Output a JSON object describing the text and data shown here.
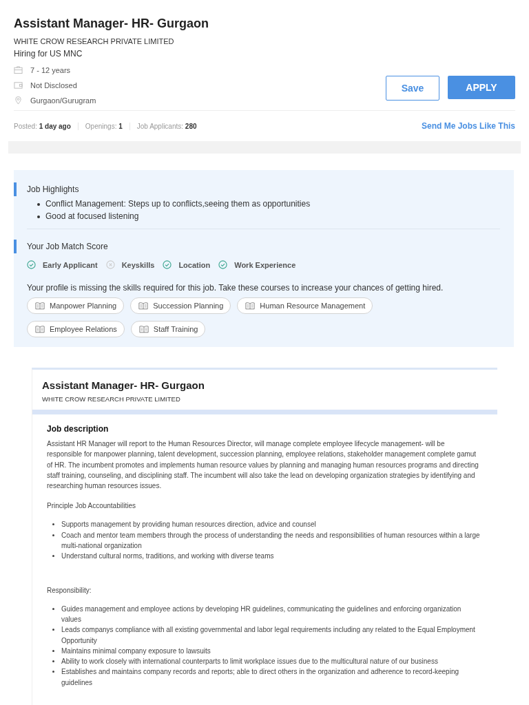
{
  "job": {
    "title": "Assistant Manager- HR- Gurgaon",
    "company": "WHITE CROW RESEARCH PRIVATE LIMITED",
    "hiring_for": "Hiring for US MNC",
    "details": [
      {
        "kind": "experience",
        "text": "7 - 12 years"
      },
      {
        "kind": "salary",
        "text": "Not Disclosed"
      },
      {
        "kind": "location",
        "text": "Gurgaon/Gurugram"
      }
    ],
    "buttons": {
      "save": "Save",
      "apply": "APPLY"
    },
    "stats": [
      {
        "label": "Posted:",
        "value": "1 day ago"
      },
      {
        "label": "Openings:",
        "value": "1"
      },
      {
        "label": "Job Applicants:",
        "value": "280"
      }
    ],
    "send_link": "Send Me Jobs Like This"
  },
  "highlights": {
    "title": "Job Highlights",
    "items": [
      "Conflict Management: Steps up to conflicts,seeing them as opportunities",
      "Good at focused listening"
    ]
  },
  "match_score": {
    "title": "Your Job Match Score",
    "items": [
      {
        "label": "Early Applicant",
        "checked": true
      },
      {
        "label": "Keyskills",
        "checked": false
      },
      {
        "label": "Location",
        "checked": true
      },
      {
        "label": "Work Experience",
        "checked": true
      }
    ],
    "missing_text": "Your profile is missing the skills required for this job. Take these courses to increase your chances of getting hired.",
    "courses": [
      "Manpower Planning",
      "Succession Planning",
      "Human Resource Management",
      "Employee Relations",
      "Staff Training"
    ]
  },
  "description": {
    "title": "Assistant Manager- HR- Gurgaon",
    "company": "WHITE CROW RESEARCH PRIVATE LIMITED",
    "heading": "Job description",
    "intro": "Assistant HR Manager will report to the Human Resources Director, will manage complete employee lifecycle management- will be responsible for manpower planning, talent development, succession planning, employee relations, stakeholder management complete gamut of HR. The incumbent promotes and implements human resource values by planning and managing human resources programs and directing staff training, counseling, and disciplining staff. The incumbent will also take the lead on developing organization strategies by identifying and researching human resources issues.",
    "sections": [
      {
        "title": "Principle Job Accountabilities",
        "items": [
          "Supports management by providing human resources direction, advice and counsel",
          "Coach and mentor team members through the process of understanding the needs and responsibilities of human resources within a large multi-national organization",
          "Understand cultural norms, traditions, and working with diverse teams"
        ]
      },
      {
        "title": "Responsibility:",
        "items": [
          "Guides management and employee actions by developing HR guidelines, communicating the guidelines and enforcing organization values",
          "Leads companys compliance with all existing governmental and labor legal requirements including any related to the Equal Employment Opportunity",
          "Maintains minimal company exposure to lawsuits",
          "Ability to work closely with international counterparts to limit workplace issues due to the multicultural nature of our business",
          "Establishes and maintains company records and reports; able to direct others in the organization and adherence to record-keeping guidelines"
        ]
      }
    ]
  }
}
